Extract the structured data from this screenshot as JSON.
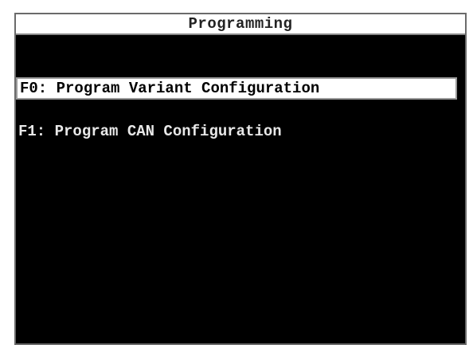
{
  "title": "Programming",
  "menu": {
    "items": [
      {
        "label": "F0: Program Variant Configuration",
        "selected": true
      },
      {
        "label": "F1: Program CAN Configuration",
        "selected": false
      }
    ]
  },
  "colors": {
    "screen_background": "#000000",
    "title_background": "#ffffff",
    "highlight_background": "#ffffff",
    "text": "#e8e8e8",
    "highlight_text": "#000000"
  }
}
